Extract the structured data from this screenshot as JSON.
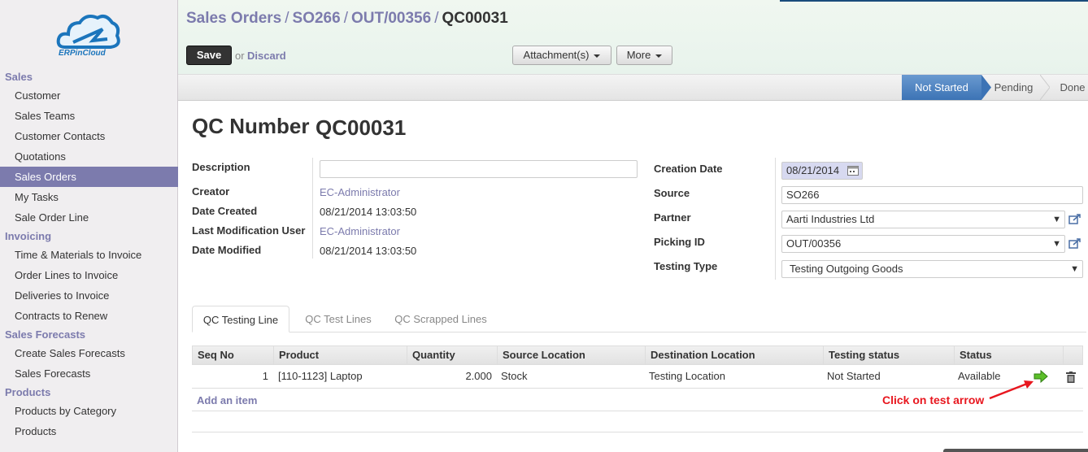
{
  "sidebar": {
    "logo_text": "ERPinCloud",
    "sections": [
      {
        "title": "Sales",
        "items": [
          "Customer",
          "Sales Teams",
          "Customer Contacts",
          "Quotations",
          "Sales Orders",
          "My Tasks",
          "Sale Order Line"
        ]
      },
      {
        "title": "Invoicing",
        "items": [
          "Time & Materials to Invoice",
          "Order Lines to Invoice",
          "Deliveries to Invoice",
          "Contracts to Renew"
        ]
      },
      {
        "title": "Sales Forecasts",
        "items": [
          "Create Sales Forecasts",
          "Sales Forecasts"
        ]
      },
      {
        "title": "Products",
        "items": [
          "Products by Category",
          "Products"
        ]
      }
    ],
    "active_item": "Sales Orders"
  },
  "breadcrumb": {
    "items": [
      "Sales Orders",
      "SO266",
      "OUT/00356"
    ],
    "separator": "/",
    "current": "QC00031"
  },
  "toolbar": {
    "save_label": "Save",
    "or_label": "or",
    "discard_label": "Discard",
    "attachments_label": "Attachment(s)",
    "more_label": "More"
  },
  "statusbar": {
    "stages": [
      "Not Started",
      "Pending",
      "Done"
    ],
    "active": "Not Started"
  },
  "form": {
    "qc_number_label": "QC Number",
    "qc_number": "QC00031",
    "description_label": "Description",
    "description_value": "",
    "creator_label": "Creator",
    "creator": "EC-Administrator",
    "date_created_label": "Date Created",
    "date_created": "08/21/2014 13:03:50",
    "last_mod_user_label": "Last Modification User",
    "last_mod_user": "EC-Administrator",
    "date_modified_label": "Date Modified",
    "date_modified": "08/21/2014 13:03:50",
    "creation_date_label": "Creation Date",
    "creation_date": "08/21/2014",
    "source_label": "Source",
    "source": "SO266",
    "partner_label": "Partner",
    "partner": "Aarti Industries Ltd",
    "picking_label": "Picking ID",
    "picking": "OUT/00356",
    "testing_type_label": "Testing Type",
    "testing_type": "Testing Outgoing Goods"
  },
  "tabs": [
    "QC Testing Line",
    "QC Test Lines",
    "QC Scrapped Lines"
  ],
  "active_tab": "QC Testing Line",
  "table": {
    "columns": [
      "Seq No",
      "Product",
      "Quantity",
      "Source Location",
      "Destination Location",
      "Testing status",
      "Status"
    ],
    "rows": [
      {
        "seq": "1",
        "product": "[110-1123] Laptop",
        "quantity": "2.000",
        "source": "Stock",
        "destination": "Testing Location",
        "testing_status": "Not Started",
        "status": "Available"
      }
    ],
    "add_item_label": "Add an item"
  },
  "annotation": "Click on test arrow",
  "colors": {
    "accent": "#7c7bad",
    "status_active": "#3c73b5",
    "annotation": "#e8171f",
    "arrow": "#4caf2a"
  }
}
